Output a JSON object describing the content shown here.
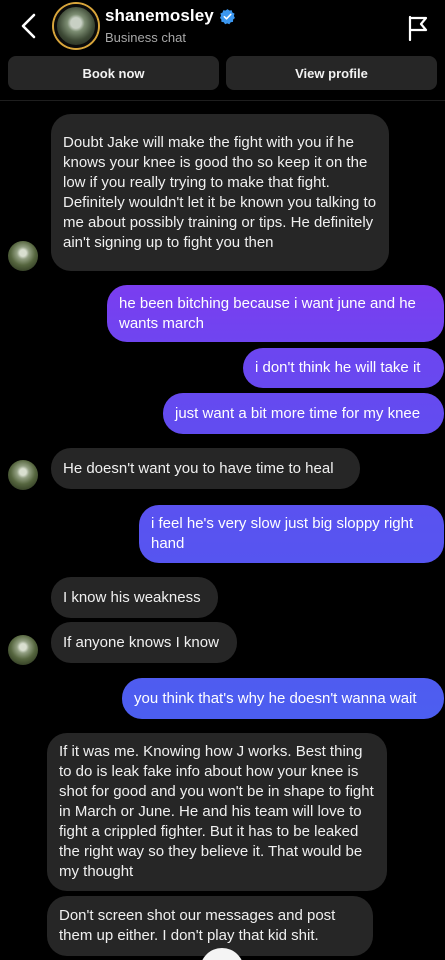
{
  "header": {
    "username": "shanemosley",
    "subtitle": "Business chat"
  },
  "actions": {
    "book": "Book now",
    "profile": "View profile"
  },
  "colors": {
    "incoming_bubble": "#262626",
    "outgoing_gradient_top": "#7a3df0",
    "outgoing_gradient_bottom": "#4f5cf0",
    "verified_badge": "#3b97f0"
  },
  "messages": [
    {
      "sender": "them",
      "text": "Doubt Jake will make the fight with you if he knows your knee is good tho so keep it on the low if you really trying to make that fight. Definitely wouldn't let it be known you talking to me about possibly training or tips. He definitely ain't signing up to fight you then"
    },
    {
      "sender": "me",
      "text": "he been bitching because i want june and he wants march"
    },
    {
      "sender": "me",
      "text": "i don't think he will take it"
    },
    {
      "sender": "me",
      "text": "just want a bit more time for my knee"
    },
    {
      "sender": "them",
      "text": "He doesn't want you to have time to heal"
    },
    {
      "sender": "me",
      "text": "i feel he's very slow just big sloppy right hand"
    },
    {
      "sender": "them",
      "text": "I know his weakness"
    },
    {
      "sender": "them",
      "text": "If anyone knows I know"
    },
    {
      "sender": "me",
      "text": "you think that's why he doesn't wanna wait"
    },
    {
      "sender": "them",
      "text": "If it was me. Knowing how J works. Best thing to do is leak fake info about how your knee is shot for good and you won't be in shape to fight in March or June.  He and his team will love to fight a crippled fighter. But it has to be leaked the right way so they believe it. That would be my thought"
    },
    {
      "sender": "them",
      "text": "Don't screen shot our messages and post them up either. I don't play that kid shit."
    }
  ]
}
